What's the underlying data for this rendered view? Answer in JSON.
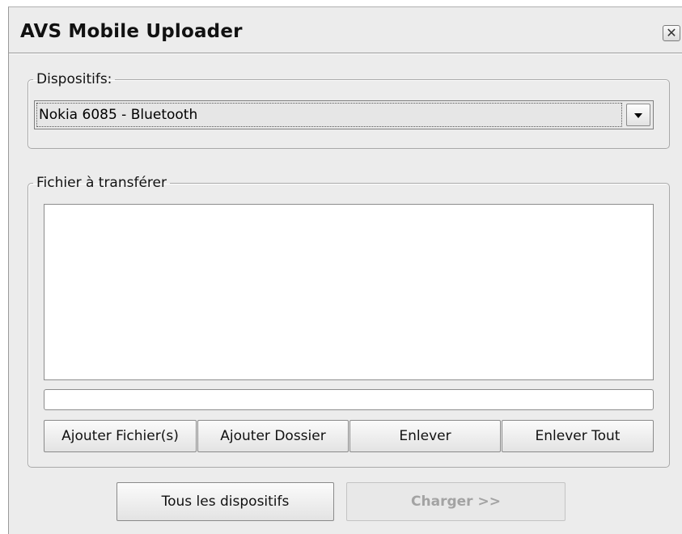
{
  "window": {
    "title": "AVS Mobile Uploader",
    "close_glyph": "✕"
  },
  "devices": {
    "legend": "Dispositifs:",
    "selected": "Nokia 6085 - Bluetooth"
  },
  "files": {
    "legend": "Fichier à transférer",
    "items": [],
    "progress": 0
  },
  "file_buttons": {
    "add_files": "Ajouter Fichier(s)",
    "add_folder": "Ajouter Dossier",
    "remove": "Enlever",
    "remove_all": "Enlever Tout"
  },
  "footer": {
    "all_devices": "Tous les dispositifs",
    "upload": "Charger >>"
  },
  "icons": {
    "close": "close-icon",
    "dropdown": "chevron-down-icon"
  }
}
